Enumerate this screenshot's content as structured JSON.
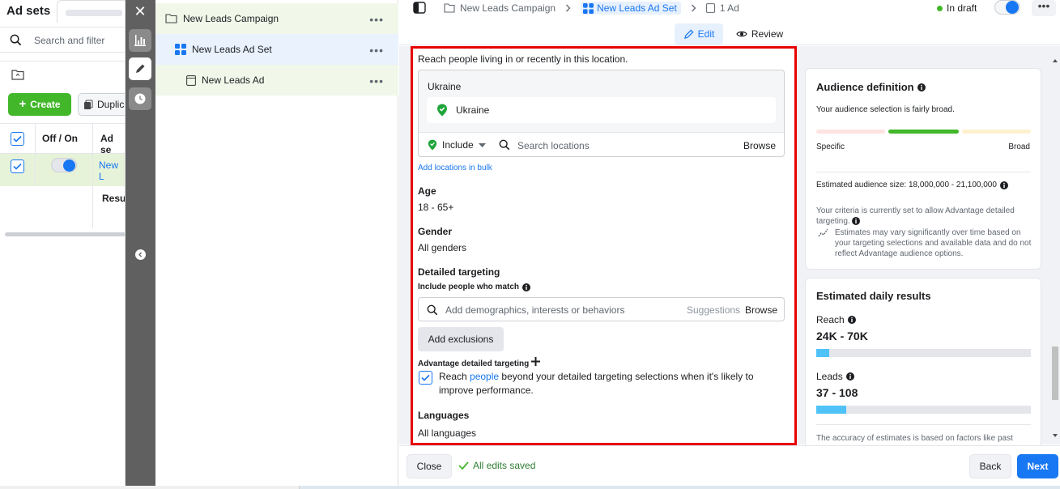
{
  "left_panel": {
    "title": "Ad sets",
    "search_placeholder": "Search and filter",
    "create_label": "Create",
    "duplicate_label": "Duplic",
    "col_on_off": "Off / On",
    "col_ad_set": "Ad se",
    "row_name": "New L",
    "results_label": "Resul"
  },
  "tree": {
    "campaign": "New Leads Campaign",
    "ad_set": "New Leads Ad Set",
    "ad": "New Leads Ad",
    "more": "•••"
  },
  "topbar": {
    "crumb_campaign": "New Leads Campaign",
    "crumb_adset": "New Leads Ad Set",
    "crumb_ads": "1 Ad",
    "status": "In draft",
    "more": "•••",
    "tab_edit": "Edit",
    "tab_review": "Review"
  },
  "form": {
    "location_intro": "Reach people living in or recently in this location.",
    "location_box_title": "Ukraine",
    "location_chip": "Ukraine",
    "include_label": "Include",
    "location_search_placeholder": "Search locations",
    "browse_label": "Browse",
    "bulk_link": "Add locations in bulk",
    "age_label": "Age",
    "age_value": "18 - 65+",
    "gender_label": "Gender",
    "gender_value": "All genders",
    "detailed_label": "Detailed targeting",
    "include_match_label": "Include people who match",
    "detailed_placeholder": "Add demographics, interests or behaviors",
    "suggestions_label": "Suggestions",
    "detailed_browse": "Browse",
    "exclusions_button": "Add exclusions",
    "advantage_label": "Advantage detailed targeting",
    "advantage_text_before": "Reach",
    "advantage_link": "people",
    "advantage_text_after": "beyond your detailed targeting selections when it's likely to improve performance.",
    "advantage_checked": true,
    "languages_label": "Languages",
    "languages_value": "All languages"
  },
  "audience_card": {
    "title": "Audience definition",
    "subtitle": "Your audience selection is fairly broad.",
    "gauge_left": "Specific",
    "gauge_right": "Broad",
    "gauge_level": "broad-middle",
    "estimated_size": "Estimated audience size: 18,000,000 - 21,100,000",
    "criteria_note": "Your criteria is currently set to allow Advantage detailed targeting.",
    "estimates_note": "Estimates may vary significantly over time based on your targeting selections and available data and do not reflect Advantage audience options."
  },
  "results_card": {
    "title": "Estimated daily results",
    "reach_label": "Reach",
    "reach_value": "24K - 70K",
    "reach_fill": 0.06,
    "leads_label": "Leads",
    "leads_value": "37 - 108",
    "leads_fill": 0.14,
    "accuracy_note": "The accuracy of estimates is based on factors like past"
  },
  "footer": {
    "close_label": "Close",
    "saved_label": "All edits saved",
    "back_label": "Back",
    "next_label": "Next"
  },
  "colors": {
    "accent": "#1877f2",
    "highlight_border": "#e80000",
    "success": "#42b72a"
  }
}
